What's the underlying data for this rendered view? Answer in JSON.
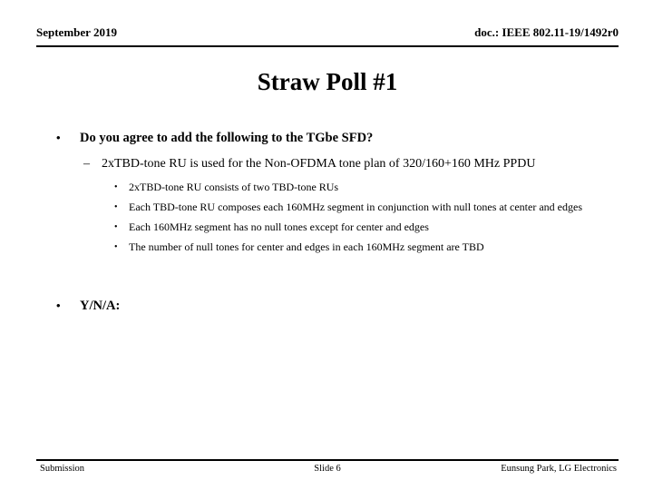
{
  "header": {
    "left": "September 2019",
    "right": "doc.: IEEE 802.11-19/1492r0"
  },
  "title": "Straw Poll #1",
  "bullets": {
    "level1_question": {
      "marker": "•",
      "text": "Do you agree to add the following to the TGbe SFD?"
    },
    "level2_item": {
      "marker": "–",
      "text": "2xTBD-tone RU is used for the Non-OFDMA tone plan of 320/160+160 MHz PPDU"
    },
    "level3_items": [
      {
        "marker": "•",
        "text": "2xTBD-tone RU consists of two TBD-tone RUs"
      },
      {
        "marker": "•",
        "text": "Each TBD-tone RU composes each 160MHz segment in conjunction with null tones at center and edges"
      },
      {
        "marker": "•",
        "text": "Each 160MHz segment has no null tones except for center and edges"
      },
      {
        "marker": "•",
        "text": "The number of null tones for center and edges in each 160MHz segment are TBD"
      }
    ],
    "level1_vote": {
      "marker": "•",
      "text": "Y/N/A:"
    }
  },
  "footer": {
    "left": "Submission",
    "center": "Slide 6",
    "right": "Eunsung Park, LG Electronics"
  },
  "colors": {
    "text": "#000000",
    "background": "#ffffff",
    "rule": "#000000"
  }
}
